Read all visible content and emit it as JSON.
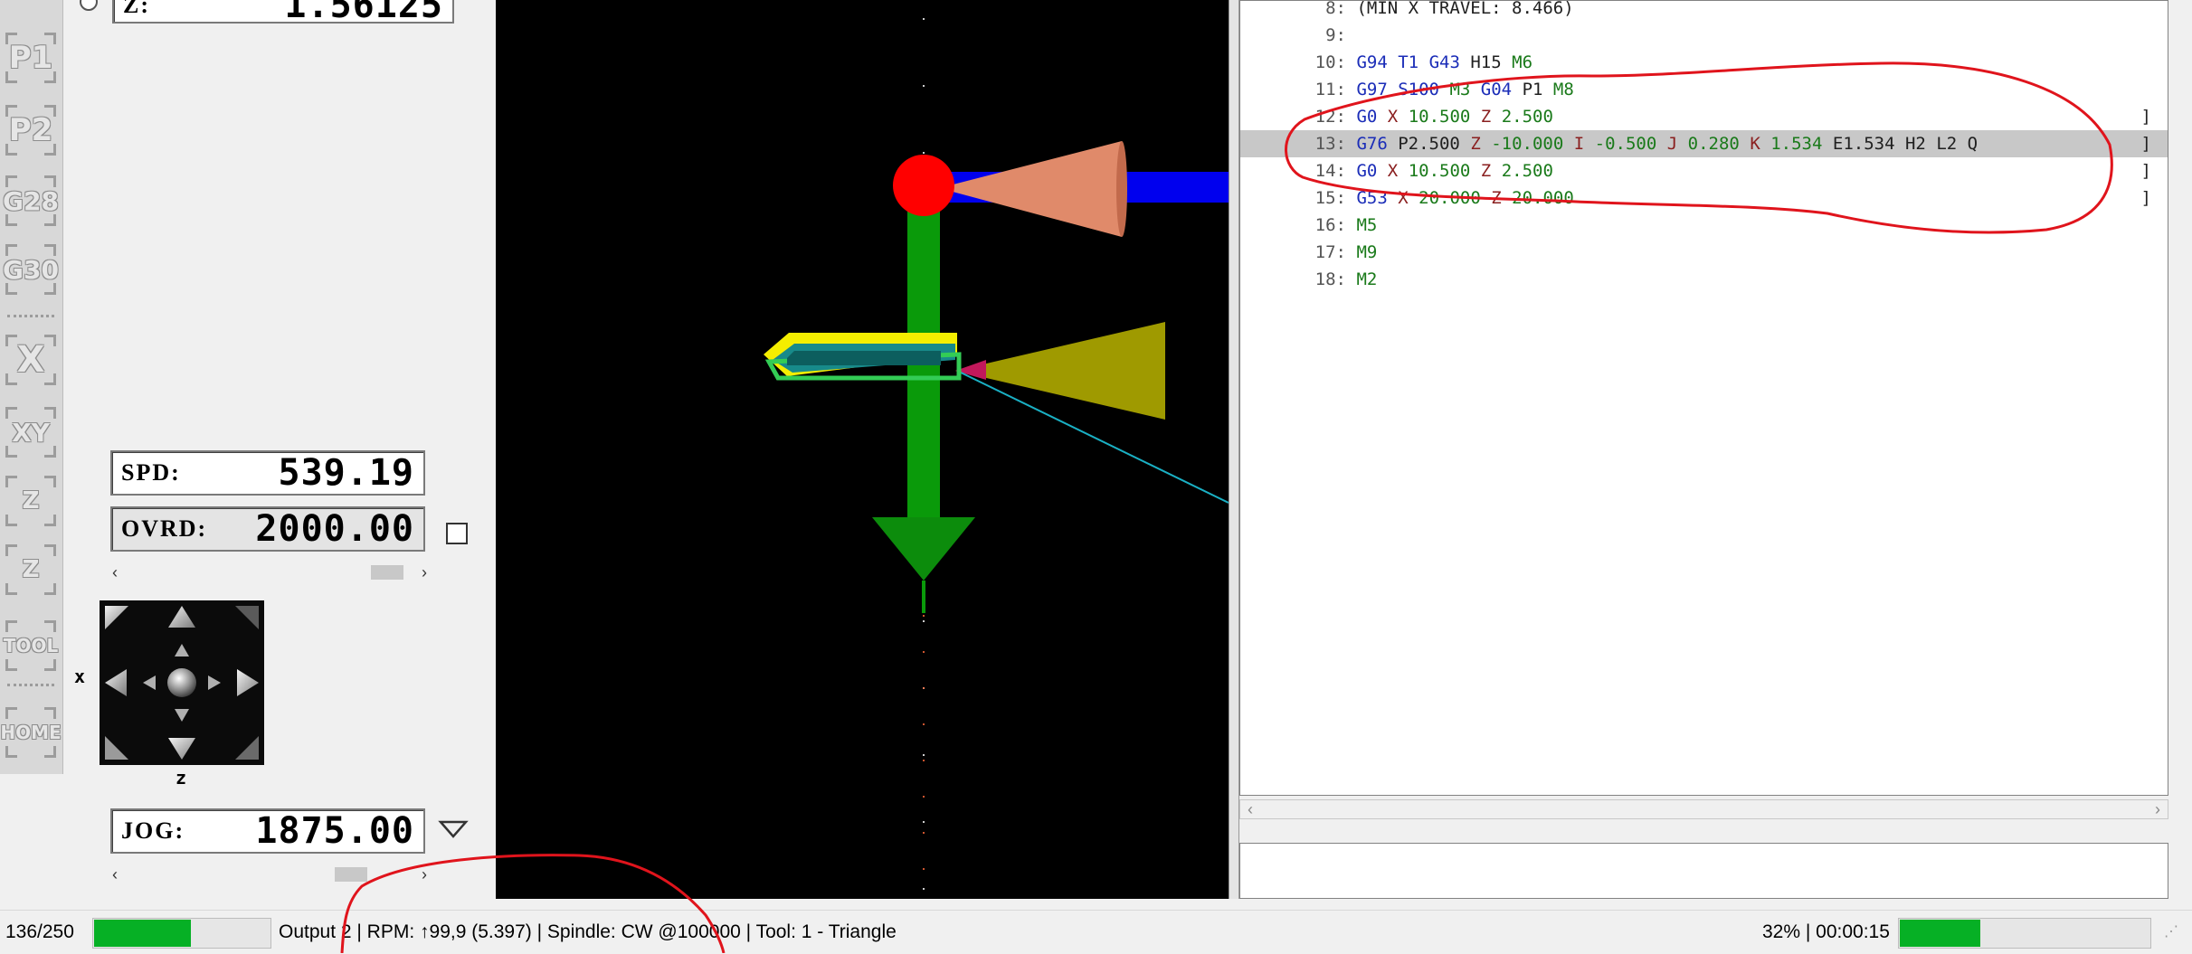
{
  "left_strip": {
    "buttons": [
      {
        "name": "p1-button",
        "label": "P1"
      },
      {
        "name": "p2-button",
        "label": "P2"
      },
      {
        "name": "g28-button",
        "label": "G28"
      },
      {
        "name": "g30-button",
        "label": "G30"
      },
      {
        "name": "x-zero-button",
        "label": "X"
      },
      {
        "name": "xy-zero-button",
        "label": "XY"
      },
      {
        "name": "z-zero-button",
        "label": "Z"
      },
      {
        "name": "z-probe-button",
        "label": "Z"
      },
      {
        "name": "tool-button",
        "label": "TOOL"
      },
      {
        "name": "home-button",
        "label": "HOME"
      }
    ]
  },
  "dro": {
    "z_label": "Z:",
    "z_value": "1.56125"
  },
  "spindle": {
    "spd_label": "SPD:",
    "spd_value": "539.19",
    "ovrd_label": "OVRD:",
    "ovrd_value": "2000.00"
  },
  "jog": {
    "x_axis_label": "x",
    "z_axis_label": "z",
    "jog_label": "JOG:",
    "jog_value": "1875.00"
  },
  "program": {
    "lines": [
      {
        "n": "8:",
        "segments": [
          {
            "t": "(MIN X TRAVEL: 8.466)",
            "c": "pl"
          }
        ]
      },
      {
        "n": "9:",
        "segments": []
      },
      {
        "n": "10:",
        "segments": [
          {
            "t": "G94",
            "c": "gc"
          },
          {
            "t": " "
          },
          {
            "t": "T1",
            "c": "gc"
          },
          {
            "t": " "
          },
          {
            "t": "G43",
            "c": "gc"
          },
          {
            "t": " "
          },
          {
            "t": "H15",
            "c": "pl"
          },
          {
            "t": " "
          },
          {
            "t": "M6",
            "c": "mc"
          }
        ]
      },
      {
        "n": "11:",
        "segments": [
          {
            "t": "G97",
            "c": "gc"
          },
          {
            "t": " "
          },
          {
            "t": "S100",
            "c": "gc"
          },
          {
            "t": " "
          },
          {
            "t": "M3",
            "c": "mc"
          },
          {
            "t": " "
          },
          {
            "t": "G04",
            "c": "gc"
          },
          {
            "t": " "
          },
          {
            "t": "P1",
            "c": "pl"
          },
          {
            "t": " "
          },
          {
            "t": "M8",
            "c": "mc"
          }
        ]
      },
      {
        "n": "12:",
        "bracket": "]",
        "segments": [
          {
            "t": "G0",
            "c": "gc"
          },
          {
            "t": " "
          },
          {
            "t": "X",
            "c": "ax"
          },
          {
            "t": " "
          },
          {
            "t": "10.500",
            "c": "nc"
          },
          {
            "t": " "
          },
          {
            "t": "Z",
            "c": "ax"
          },
          {
            "t": " "
          },
          {
            "t": "2.500",
            "c": "nc"
          }
        ]
      },
      {
        "n": "13:",
        "bracket": "]",
        "current": true,
        "segments": [
          {
            "t": "G76",
            "c": "gc"
          },
          {
            "t": " "
          },
          {
            "t": "P2.500",
            "c": "pl"
          },
          {
            "t": " "
          },
          {
            "t": "Z",
            "c": "ax"
          },
          {
            "t": " "
          },
          {
            "t": "-10.000",
            "c": "nc"
          },
          {
            "t": " "
          },
          {
            "t": "I",
            "c": "ax"
          },
          {
            "t": " "
          },
          {
            "t": "-0.500",
            "c": "nc"
          },
          {
            "t": " "
          },
          {
            "t": "J",
            "c": "ax"
          },
          {
            "t": " "
          },
          {
            "t": "0.280",
            "c": "nc"
          },
          {
            "t": " "
          },
          {
            "t": "K",
            "c": "ax"
          },
          {
            "t": " "
          },
          {
            "t": "1.534",
            "c": "nc"
          },
          {
            "t": " "
          },
          {
            "t": "E1.534",
            "c": "pl"
          },
          {
            "t": " "
          },
          {
            "t": "H2",
            "c": "pl"
          },
          {
            "t": " "
          },
          {
            "t": "L2",
            "c": "pl"
          },
          {
            "t": " "
          },
          {
            "t": "Q",
            "c": "pl"
          }
        ]
      },
      {
        "n": "14:",
        "bracket": "]",
        "segments": [
          {
            "t": "G0",
            "c": "gc"
          },
          {
            "t": " "
          },
          {
            "t": "X",
            "c": "ax"
          },
          {
            "t": " "
          },
          {
            "t": "10.500",
            "c": "nc"
          },
          {
            "t": " "
          },
          {
            "t": "Z",
            "c": "ax"
          },
          {
            "t": " "
          },
          {
            "t": "2.500",
            "c": "nc"
          }
        ]
      },
      {
        "n": "15:",
        "bracket": "]",
        "segments": [
          {
            "t": "G53",
            "c": "gc"
          },
          {
            "t": " "
          },
          {
            "t": "X",
            "c": "ax"
          },
          {
            "t": " "
          },
          {
            "t": "20.000",
            "c": "nc"
          },
          {
            "t": " "
          },
          {
            "t": "Z",
            "c": "ax"
          },
          {
            "t": " "
          },
          {
            "t": "20.000",
            "c": "nc"
          }
        ]
      },
      {
        "n": "16:",
        "segments": [
          {
            "t": "M5",
            "c": "mc"
          }
        ]
      },
      {
        "n": "17:",
        "segments": [
          {
            "t": "M9",
            "c": "mc"
          }
        ]
      },
      {
        "n": "18:",
        "segments": [
          {
            "t": "M2",
            "c": "mc"
          }
        ]
      }
    ]
  },
  "status_bar": {
    "line_progress_text": "136/250",
    "line_progress": 0.544,
    "status_text": "Output 2 | RPM: ↑99,9 (5.397) | Spindle: CW @100000 | Tool: 1 - Triangle",
    "right_text": "32% | 00:00:15",
    "job_progress": 0.32
  },
  "viewport": {
    "tool_name": "Triangle"
  },
  "colors": {
    "progress_green": "#06b025",
    "annotation_red": "#e0141c",
    "spindle_marker": "#ff0000",
    "x_axis_arrow": "#0000ff",
    "z_axis_arrow": "#0a9a0a",
    "tool_insert": "#ffff00"
  }
}
